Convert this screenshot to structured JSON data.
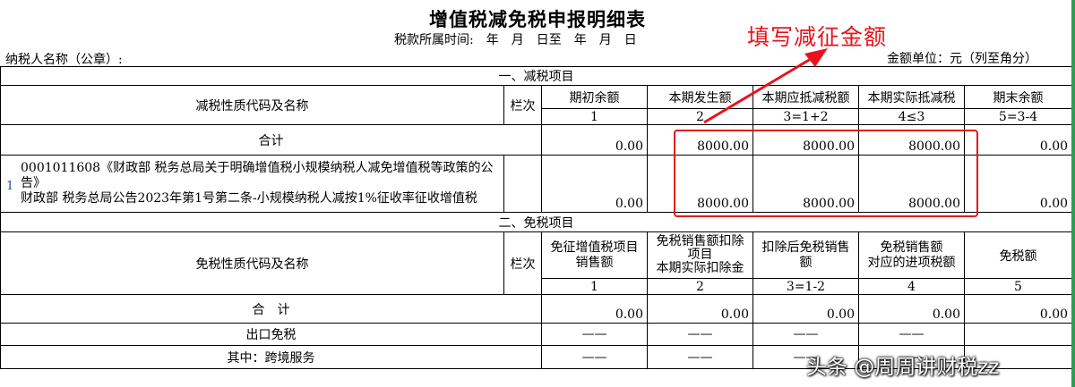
{
  "header": {
    "title": "增值税减免税申报明细表",
    "period_label": "税款所属时间:　年　月　日至　年　月　日",
    "taxpayer_label": "纳税人名称（公章）:",
    "unit_label": "金额单位：元（列至角分）"
  },
  "annotation": {
    "text": "填写减征金额",
    "color": "#e8141d"
  },
  "reduction": {
    "section_title": "一、减税项目",
    "name_header": "减税性质代码及名称",
    "lanci_header": "栏次",
    "columns": [
      "期初余额",
      "本期发生额",
      "本期应抵减税额",
      "本期实际抵减税",
      "期末余额"
    ],
    "col_numbers": [
      "1",
      "2",
      "3=1+2",
      "4≤3",
      "5=3-4"
    ],
    "total_label": "合计",
    "total_values": [
      "0.00",
      "8000.00",
      "8000.00",
      "8000.00",
      "0.00"
    ],
    "rows": [
      {
        "index": "1",
        "name_line1": "0001011608《财政部 税务总局关于明确增值税小规模纳税人减免增值税等政策的公告》",
        "name_line2": "财政部 税务总局公告2023年第1号第二条-小规模纳税人减按1%征收率征收增值税",
        "values": [
          "0.00",
          "8000.00",
          "8000.00",
          "8000.00",
          "0.00"
        ]
      }
    ]
  },
  "exemption": {
    "section_title": "二、免税项目",
    "name_header": "免税性质代码及名称",
    "lanci_header": "栏次",
    "col1": "免征增值税项目销售额",
    "col2_line1": "免税销售额扣除",
    "col2_line2": "项目",
    "col2_line3": "本期实际扣除金",
    "col3": "扣除后免税销售额",
    "col4_line1": "免税销售额",
    "col4_line2": "对应的进项税额",
    "col5": "免税额",
    "col_numbers": [
      "1",
      "2",
      "3=1-2",
      "4",
      "5"
    ],
    "total_label": "合　计",
    "total_values": [
      "0.00",
      "0.00",
      "0.00",
      "0.00",
      "0.00"
    ],
    "export_label": "出口免税",
    "export_values": [
      "——",
      "——",
      "——",
      "——",
      ""
    ],
    "cross_label": "其中：跨境服务",
    "cross_values": [
      "——",
      "——",
      "——",
      "——",
      ""
    ]
  },
  "watermark": "头条 @周周讲财税zz"
}
